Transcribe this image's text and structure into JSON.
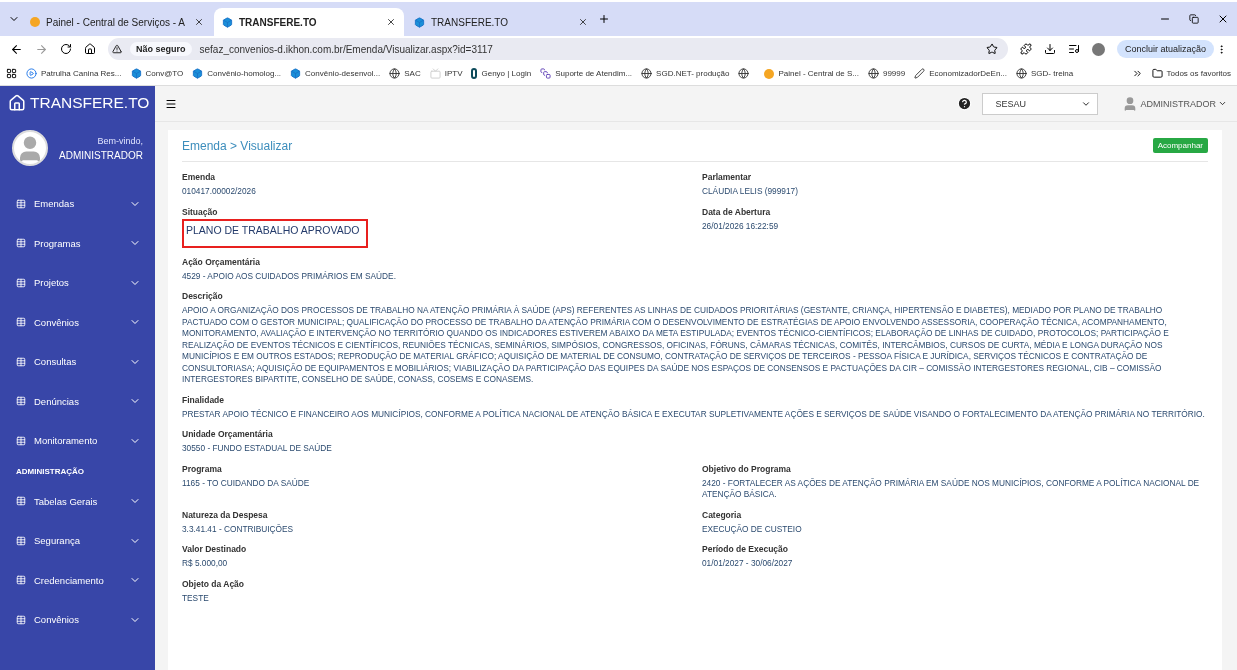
{
  "browser": {
    "tabs": [
      {
        "title": "Painel - Central de Serviços - A",
        "selected": false
      },
      {
        "title": "TRANSFERE.TO",
        "selected": true
      },
      {
        "title": "TRANSFERE.TO",
        "selected": false
      }
    ],
    "security": "Não seguro",
    "url": "sefaz_convenios-d.ikhon.com.br/Emenda/Visualizar.aspx?id=3117",
    "update_button": "Concluir atualização",
    "bookmarks": [
      {
        "label": "Patrulha Canina Res..."
      },
      {
        "label": "Conv@TO"
      },
      {
        "label": "Convênio-homolog..."
      },
      {
        "label": "Convênio-desenvol..."
      },
      {
        "label": "SAC"
      },
      {
        "label": "IPTV"
      },
      {
        "label": "Genyo | Login"
      },
      {
        "label": "Suporte de Atendim..."
      },
      {
        "label": "SGD.NET- produção"
      },
      {
        "label": "Painel - Central de S..."
      },
      {
        "label": "99999"
      },
      {
        "label": "EconomizadorDeEn..."
      },
      {
        "label": "SGD- treina"
      }
    ],
    "all_bookmarks": "Todos os favoritos"
  },
  "app": {
    "logo": "TRANSFERE.TO",
    "welcome": "Bem-vindo,",
    "user": "ADMINISTRADOR",
    "menu": [
      {
        "kind": "item",
        "label": "Emendas"
      },
      {
        "kind": "item",
        "label": "Programas"
      },
      {
        "kind": "item",
        "label": "Projetos"
      },
      {
        "kind": "item",
        "label": "Convênios"
      },
      {
        "kind": "item",
        "label": "Consultas"
      },
      {
        "kind": "item",
        "label": "Denúncias"
      },
      {
        "kind": "item",
        "label": "Monitoramento"
      },
      {
        "kind": "section",
        "label": "ADMINISTRAÇÃO"
      },
      {
        "kind": "item",
        "label": "Tabelas Gerais"
      },
      {
        "kind": "item",
        "label": "Segurança"
      },
      {
        "kind": "item",
        "label": "Credenciamento"
      },
      {
        "kind": "item",
        "label": "Convênios"
      }
    ],
    "org_select": "SESAU",
    "header_user": "ADMINISTRADOR"
  },
  "page": {
    "breadcrumb": "Emenda > Visualizar",
    "action_button": "Acompanhar",
    "rows": [
      [
        {
          "label": "Emenda",
          "value": "010417.00002/2026"
        },
        {
          "label": "Parlamentar",
          "value": "CLÁUDIA LELIS (999917)"
        }
      ],
      [
        {
          "label": "Situação",
          "value": "PLANO DE TRABALHO APROVADO",
          "highlighted": true
        },
        {
          "label": "Data de Abertura",
          "value": "26/01/2026 16:22:59"
        }
      ],
      [
        {
          "label": "Ação Orçamentária",
          "value": "4529 - APOIO AOS CUIDADOS PRIMÁRIOS EM SAÚDE."
        }
      ],
      [
        {
          "label": "Descrição",
          "value": "APOIO A ORGANIZAÇÃO DOS PROCESSOS DE TRABALHO NA ATENÇÃO PRIMÁRIA À SAÚDE (APS) REFERENTES AS LINHAS DE CUIDADOS PRIORITÁRIAS (GESTANTE, CRIANÇA, HIPERTENSÃO E DIABETES), MEDIADO POR PLANO DE TRABALHO PACTUADO COM O GESTOR MUNICIPAL; QUALIFICAÇÃO DO PROCESSO DE TRABALHO DA ATENÇÃO PRIMÁRIA COM O DESENVOLVIMENTO DE ESTRATÉGIAS DE APOIO ENVOLVENDO ASSESSORIA, COOPERAÇÃO TÉCNICA, ACOMPANHAMENTO, MONITORAMENTO, AVALIAÇÃO E INTERVENÇÃO NO TERRITÓRIO QUANDO OS INDICADORES ESTIVEREM ABAIXO DA META ESTIPULADA; EVENTOS TÉCNICO-CIENTÍFICOS; ELABORAÇÃO DE LINHAS DE CUIDADO, PROTOCOLOS; PARTICIPAÇÃO E REALIZAÇÃO DE EVENTOS TÉCNICOS E CIENTÍFICOS, REUNIÕES TÉCNICAS, SEMINÁRIOS, SIMPÓSIOS, CONGRESSOS, OFICINAS, FÓRUNS, CÂMARAS TÉCNICAS, COMITÊS, INTERCÂMBIOS, CURSOS DE CURTA, MÉDIA E LONGA DURAÇÃO NOS MUNICÍPIOS E EM OUTROS ESTADOS; REPRODUÇÃO DE MATERIAL GRÁFICO; AQUISIÇÃO DE MATERIAL DE CONSUMO, CONTRATAÇÃO DE SERVIÇOS DE TERCEIROS - PESSOA FÍSICA E JURÍDICA, SERVIÇOS TÉCNICOS E CONTRATAÇÃO DE CONSULTORIASA; AQUISIÇÃO DE EQUIPAMENTOS E MOBILIÁRIOS; VIABILIZAÇÃO DA PARTICIPAÇÃO DAS EQUIPES DA SAÚDE NOS ESPAÇOS DE CONSENSOS E PACTUAÇÕES DA CIR – COMISSÃO INTERGESTORES REGIONAL, CIB – COMISSÃO INTERGESTORES BIPARTITE, CONSELHO DE SAÚDE, CONASS, COSEMS E CONASEMS."
        }
      ],
      [
        {
          "label": "Finalidade",
          "value": "PRESTAR APOIO TÉCNICO E FINANCEIRO AOS MUNICÍPIOS, CONFORME A POLÍTICA NACIONAL DE ATENÇÃO BÁSICA E EXECUTAR SUPLETIVAMENTE AÇÕES E SERVIÇOS DE SAÚDE VISANDO O FORTALECIMENTO DA ATENÇÃO PRIMÁRIA NO TERRITÓRIO."
        }
      ],
      [
        {
          "label": "Unidade Orçamentária",
          "value": "30550 - FUNDO ESTADUAL DE SAÚDE"
        }
      ],
      [
        {
          "label": "Programa",
          "value": "1165 - TO CUIDANDO DA SAÚDE"
        },
        {
          "label": "Objetivo do Programa",
          "value": "2420 - FORTALECER AS AÇÕES DE ATENÇÃO PRIMÁRIA EM SAÚDE NOS MUNICÍPIOS, CONFORME A POLÍTICA NACIONAL DE ATENÇÃO BÁSICA."
        }
      ],
      [
        {
          "label": "Natureza da Despesa",
          "value": "3.3.41.41 - CONTRIBUIÇÕES"
        },
        {
          "label": "Categoria",
          "value": "EXECUÇÃO DE CUSTEIO"
        }
      ],
      [
        {
          "label": "Valor Destinado",
          "value": "R$ 5.000,00"
        },
        {
          "label": "Período de Execução",
          "value": "01/01/2027 - 30/06/2027"
        }
      ],
      [
        {
          "label": "Objeto da Ação",
          "value": "TESTE"
        }
      ]
    ]
  }
}
